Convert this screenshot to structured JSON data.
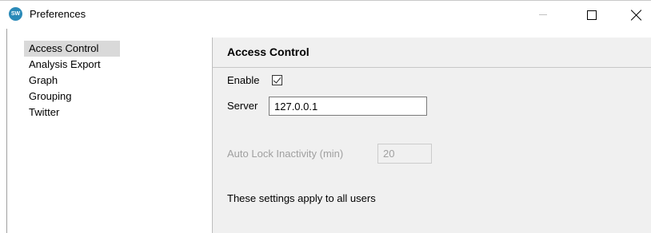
{
  "window": {
    "title": "Preferences",
    "app_icon_text": "SW",
    "controls": {
      "minimize": "minimize-icon",
      "maximize": "maximize-icon",
      "close": "close-icon"
    }
  },
  "sidebar": {
    "items": [
      {
        "label": "Access Control",
        "selected": true
      },
      {
        "label": "Analysis Export",
        "selected": false
      },
      {
        "label": "Graph",
        "selected": false
      },
      {
        "label": "Grouping",
        "selected": false
      },
      {
        "label": "Twitter",
        "selected": false
      }
    ]
  },
  "panel": {
    "title": "Access Control",
    "enable": {
      "label": "Enable",
      "checked": true
    },
    "server": {
      "label": "Server",
      "value": "127.0.0.1"
    },
    "auto_lock": {
      "label": "Auto Lock Inactivity (min)",
      "value": "20",
      "disabled": true
    },
    "note": "These settings apply to all users"
  },
  "colors": {
    "panel_bg": "#f0f0f0",
    "selected_item_bg": "#d9d9d9",
    "disabled_text": "#a0a0a0",
    "app_icon": "#2a8ab8"
  }
}
